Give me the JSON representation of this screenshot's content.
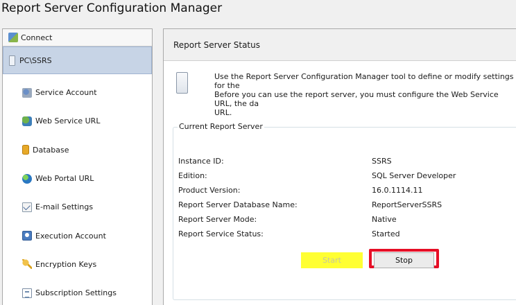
{
  "window": {
    "title": "Report Server Configuration Manager"
  },
  "sidebar": {
    "connect_label": "Connect",
    "server_label": "PC\\SSRS",
    "items": [
      {
        "label": "Service Account",
        "icon": "service-account-icon"
      },
      {
        "label": "Web Service URL",
        "icon": "web-service-url-icon"
      },
      {
        "label": "Database",
        "icon": "database-icon"
      },
      {
        "label": "Web Portal URL",
        "icon": "web-portal-globe-icon"
      },
      {
        "label": "E-mail Settings",
        "icon": "email-settings-icon"
      },
      {
        "label": "Execution Account",
        "icon": "execution-account-icon"
      },
      {
        "label": "Encryption Keys",
        "icon": "encryption-keys-icon"
      },
      {
        "label": "Subscription Settings",
        "icon": "subscription-settings-icon"
      }
    ]
  },
  "main": {
    "header": "Report Server Status",
    "intro": "Use the Report Server Configuration Manager tool to define or modify settings for the\nBefore you can use the report server, you must configure the Web Service URL, the da\nURL.",
    "group_title": "Current Report Server",
    "details": [
      {
        "key": "Instance ID:",
        "value": "SSRS"
      },
      {
        "key": "Edition:",
        "value": "SQL Server Developer"
      },
      {
        "key": "Product Version:",
        "value": "16.0.1114.11"
      },
      {
        "key": "Report Server Database Name:",
        "value": "ReportServerSSRS"
      },
      {
        "key": "Report Server Mode:",
        "value": "Native"
      },
      {
        "key": "Report Service Status:",
        "value": "Started"
      }
    ],
    "buttons": {
      "start": "Start",
      "stop": "Stop"
    }
  },
  "colors": {
    "highlight_yellow": "#ffff33",
    "annotation_red": "#e60e26",
    "selected_bg": "#c7d4e6"
  }
}
